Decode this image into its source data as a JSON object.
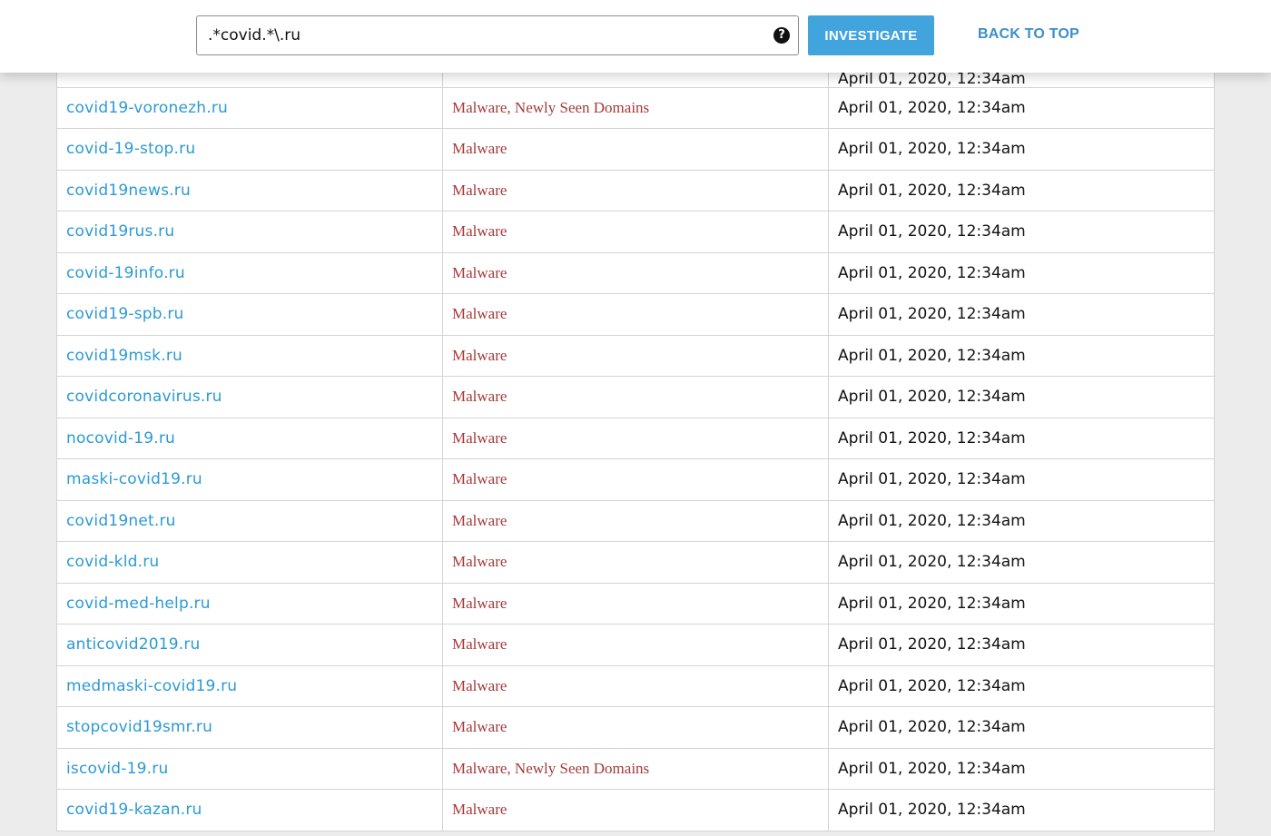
{
  "header": {
    "search_value": ".*covid.*\\.ru",
    "help_glyph": "?",
    "investigate_label": "INVESTIGATE",
    "back_to_top_label": "BACK TO TOP"
  },
  "table": {
    "partial_top_row_date": "April 01, 2020, 12:34am",
    "rows": [
      {
        "domain": "covid19-voronezh.ru",
        "category": "Malware, Newly Seen Domains",
        "date": "April 01, 2020, 12:34am"
      },
      {
        "domain": "covid-19-stop.ru",
        "category": "Malware",
        "date": "April 01, 2020, 12:34am"
      },
      {
        "domain": "covid19news.ru",
        "category": "Malware",
        "date": "April 01, 2020, 12:34am"
      },
      {
        "domain": "covid19rus.ru",
        "category": "Malware",
        "date": "April 01, 2020, 12:34am"
      },
      {
        "domain": "covid-19info.ru",
        "category": "Malware",
        "date": "April 01, 2020, 12:34am"
      },
      {
        "domain": "covid19-spb.ru",
        "category": "Malware",
        "date": "April 01, 2020, 12:34am"
      },
      {
        "domain": "covid19msk.ru",
        "category": "Malware",
        "date": "April 01, 2020, 12:34am"
      },
      {
        "domain": "covidcoronavirus.ru",
        "category": "Malware",
        "date": "April 01, 2020, 12:34am"
      },
      {
        "domain": "nocovid-19.ru",
        "category": "Malware",
        "date": "April 01, 2020, 12:34am"
      },
      {
        "domain": "maski-covid19.ru",
        "category": "Malware",
        "date": "April 01, 2020, 12:34am"
      },
      {
        "domain": "covid19net.ru",
        "category": "Malware",
        "date": "April 01, 2020, 12:34am"
      },
      {
        "domain": "covid-kld.ru",
        "category": "Malware",
        "date": "April 01, 2020, 12:34am"
      },
      {
        "domain": "covid-med-help.ru",
        "category": "Malware",
        "date": "April 01, 2020, 12:34am"
      },
      {
        "domain": "anticovid2019.ru",
        "category": "Malware",
        "date": "April 01, 2020, 12:34am"
      },
      {
        "domain": "medmaski-covid19.ru",
        "category": "Malware",
        "date": "April 01, 2020, 12:34am"
      },
      {
        "domain": "stopcovid19smr.ru",
        "category": "Malware",
        "date": "April 01, 2020, 12:34am"
      },
      {
        "domain": "iscovid-19.ru",
        "category": "Malware, Newly Seen Domains",
        "date": "April 01, 2020, 12:34am"
      },
      {
        "domain": "covid19-kazan.ru",
        "category": "Malware",
        "date": "April 01, 2020, 12:34am"
      }
    ]
  },
  "colors": {
    "link": "#2b9ad4",
    "category": "#a53a3a",
    "button": "#41a4dd",
    "back_to_top": "#3d8fc8"
  }
}
